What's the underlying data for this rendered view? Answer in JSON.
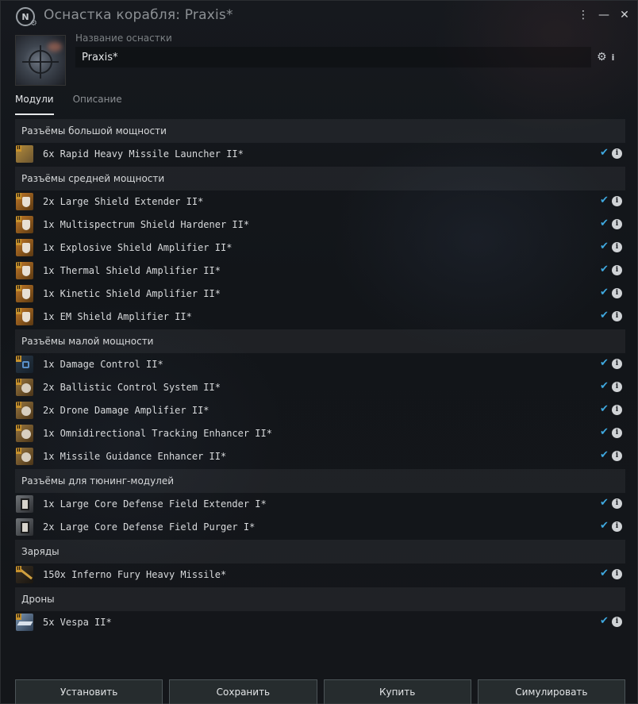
{
  "window": {
    "title": "Оснастка корабля: Praxis*",
    "controls": [
      "⋮",
      "—",
      "✕"
    ]
  },
  "header": {
    "name_label": "Название оснастки",
    "name_value": "Praxis*",
    "settings_icon": "gear-icon",
    "info_icon": "info-icon"
  },
  "tabs": [
    {
      "label": "Модули",
      "active": true
    },
    {
      "label": "Описание",
      "active": false
    }
  ],
  "sections": [
    {
      "title": "Разъёмы большой мощности",
      "items": [
        {
          "text": "6x Rapid Heavy Missile Launcher II*",
          "icon": "launcher-icon"
        }
      ]
    },
    {
      "title": " Разъёмы средней мощности",
      "items": [
        {
          "text": "2x Large Shield Extender II*",
          "icon": "shield-extender-icon"
        },
        {
          "text": "1x Multispectrum Shield Hardener II*",
          "icon": "shield-hardener-icon"
        },
        {
          "text": "1x Explosive Shield Amplifier II*",
          "icon": "shield-amplifier-icon"
        },
        {
          "text": "1x Thermal Shield Amplifier II*",
          "icon": "shield-amplifier-icon"
        },
        {
          "text": "1x Kinetic Shield Amplifier II*",
          "icon": "shield-amplifier-icon"
        },
        {
          "text": "1x EM Shield Amplifier II*",
          "icon": "shield-amplifier-icon"
        }
      ]
    },
    {
      "title": "Разъёмы малой мощности",
      "items": [
        {
          "text": "1x Damage Control II*",
          "icon": "damage-control-icon"
        },
        {
          "text": "2x Ballistic Control System II*",
          "icon": "ballistic-control-icon"
        },
        {
          "text": "2x Drone Damage Amplifier II*",
          "icon": "drone-damage-icon"
        },
        {
          "text": "1x Omnidirectional Tracking Enhancer II*",
          "icon": "tracking-enhancer-icon"
        },
        {
          "text": "1x Missile Guidance Enhancer II*",
          "icon": "guidance-enhancer-icon"
        }
      ]
    },
    {
      "title": "Разъёмы для тюнинг-модулей",
      "items": [
        {
          "text": "1x Large Core Defense Field Extender I*",
          "icon": "rig-icon"
        },
        {
          "text": "2x Large Core Defense Field Purger I*",
          "icon": "rig-icon"
        }
      ]
    },
    {
      "title": "Заряды",
      "items": [
        {
          "text": "150x Inferno Fury Heavy Missile*",
          "icon": "missile-icon"
        }
      ]
    },
    {
      "title": "Дроны",
      "items": [
        {
          "text": "5x Vespa II*",
          "icon": "drone-icon"
        }
      ]
    }
  ],
  "buttons": {
    "install": "Установить",
    "save": "Сохранить",
    "buy": "Купить",
    "simulate": "Симулировать"
  },
  "colors": {
    "check": "#3fa9e0",
    "background": "#121519"
  }
}
